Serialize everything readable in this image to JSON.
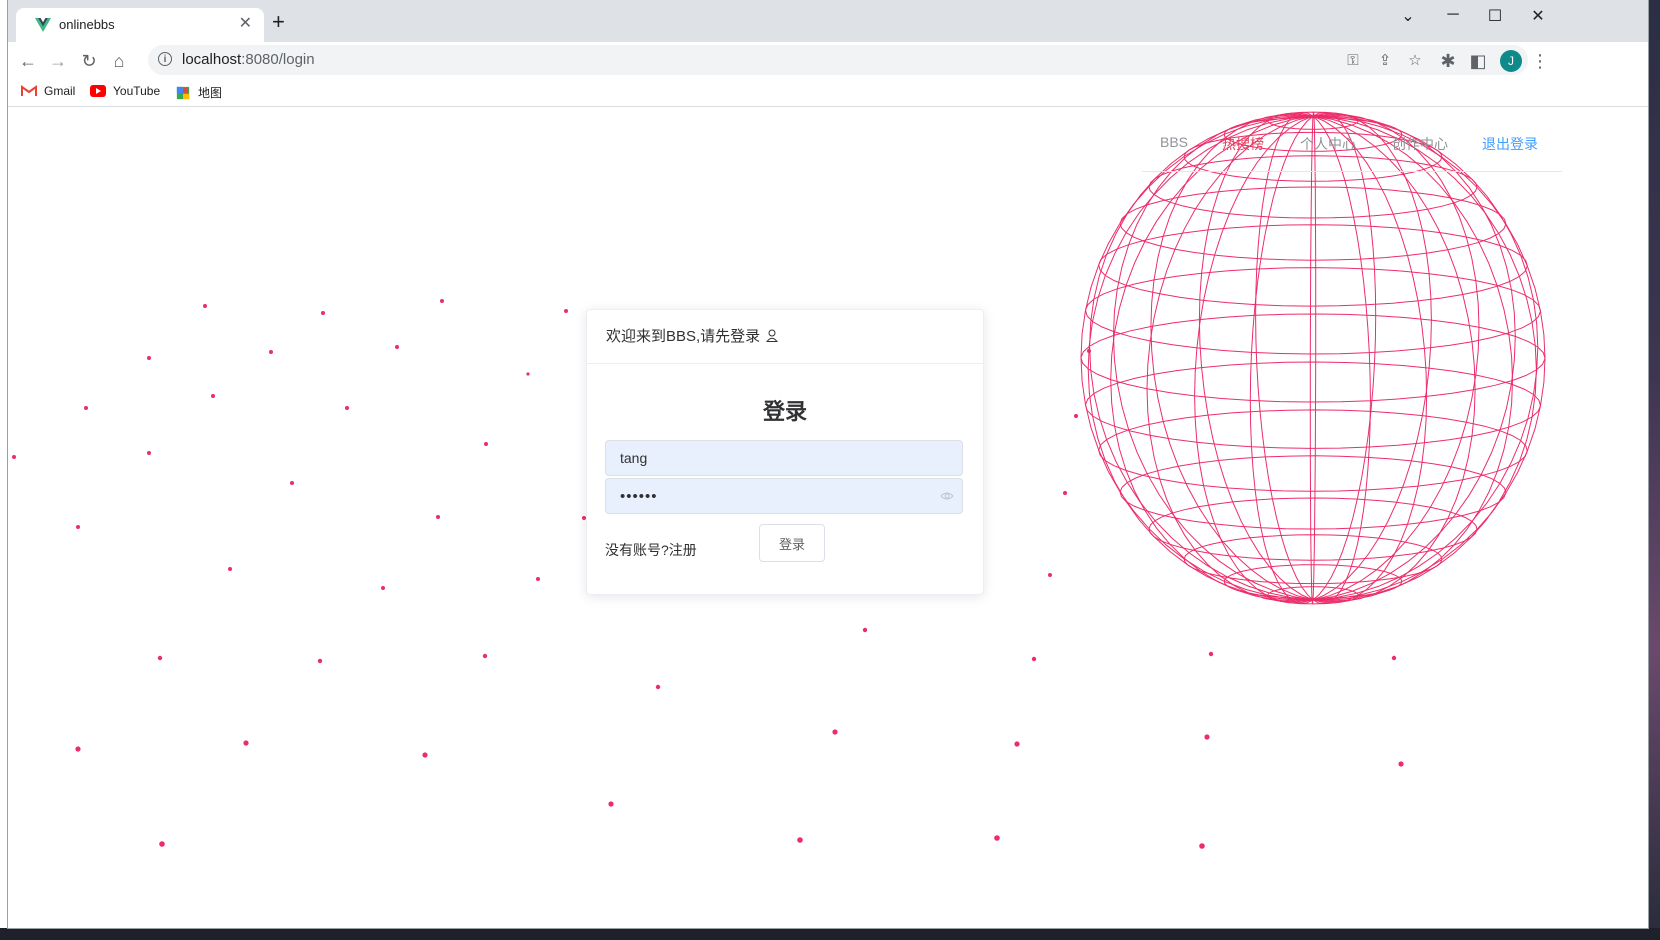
{
  "browser": {
    "tab_title": "onlinebbs",
    "url_host": "localhost",
    "url_rest": ":8080/login",
    "avatar_letter": "J",
    "bookmarks": [
      {
        "label": "Gmail"
      },
      {
        "label": "YouTube"
      },
      {
        "label": "地图"
      }
    ]
  },
  "nav": {
    "items": [
      "BBS",
      "热搜榜",
      "个人中心",
      "创作中心",
      "退出登录"
    ],
    "colors": {
      "active": "#e0405e",
      "link": "#409eff",
      "muted": "#909399"
    }
  },
  "login": {
    "header": "欢迎来到BBS,请先登录",
    "title": "登录",
    "username_value": "tang",
    "password_value": "••••••",
    "register_prefix": "没有账号?",
    "register_link": "注册",
    "button_label": "登录"
  },
  "theme": {
    "accent": "#ec2d6a"
  }
}
